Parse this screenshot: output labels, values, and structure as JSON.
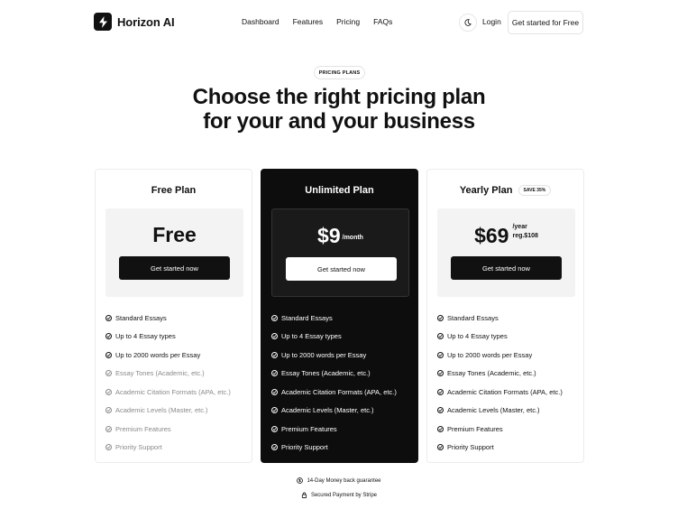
{
  "nav": {
    "brand": "Horizon AI",
    "logo_icon": "lightning-bolt-icon",
    "links": [
      "Dashboard",
      "Features",
      "Pricing",
      "FAQs"
    ],
    "theme_icon": "moon-icon",
    "login": "Login",
    "cta": "Get started for Free"
  },
  "hero": {
    "badge": "PRICING PLANS",
    "title_line1": "Choose the right pricing plan",
    "title_line2": "for your and your business"
  },
  "plans": [
    {
      "name": "Free Plan",
      "price": "Free",
      "button": "Get started now",
      "features": [
        {
          "label": "Standard Essays",
          "included": true
        },
        {
          "label": "Up to 4 Essay types",
          "included": true
        },
        {
          "label": "Up to 2000 words per Essay",
          "included": true
        },
        {
          "label": "Essay Tones (Academic, etc.)",
          "included": false
        },
        {
          "label": "Academic Citation Formats (APA, etc.)",
          "included": false
        },
        {
          "label": "Academic Levels (Master, etc.)",
          "included": false
        },
        {
          "label": "Premium Features",
          "included": false
        },
        {
          "label": "Priority Support",
          "included": false
        }
      ]
    },
    {
      "name": "Unlimited Plan",
      "price": "$9",
      "period": "/month",
      "button": "Get started now",
      "features": [
        {
          "label": "Standard Essays",
          "included": true
        },
        {
          "label": "Up to 4 Essay types",
          "included": true
        },
        {
          "label": "Up to 2000 words per Essay",
          "included": true
        },
        {
          "label": "Essay Tones (Academic, etc.)",
          "included": true
        },
        {
          "label": "Academic Citation Formats (APA, etc.)",
          "included": true
        },
        {
          "label": "Academic Levels (Master, etc.)",
          "included": true
        },
        {
          "label": "Premium Features",
          "included": true
        },
        {
          "label": "Priority Support",
          "included": true
        }
      ]
    },
    {
      "name": "Yearly Plan",
      "badge": "SAVE 35%",
      "price": "$69",
      "period": "/year",
      "regular": "reg.$108",
      "button": "Get started now",
      "features": [
        {
          "label": "Standard Essays",
          "included": true
        },
        {
          "label": "Up to 4 Essay types",
          "included": true
        },
        {
          "label": "Up to 2000 words per Essay",
          "included": true
        },
        {
          "label": "Essay Tones (Academic, etc.)",
          "included": true
        },
        {
          "label": "Academic Citation Formats (APA, etc.)",
          "included": true
        },
        {
          "label": "Academic Levels (Master, etc.)",
          "included": true
        },
        {
          "label": "Premium Features",
          "included": true
        },
        {
          "label": "Priority Support",
          "included": true
        }
      ]
    }
  ],
  "footer": {
    "guarantee": "14-Day Money back guarantee",
    "guarantee_icon": "dollar-coin-icon",
    "secure": "Secured Payment by Stripe",
    "secure_icon": "lock-icon"
  },
  "colors": {
    "accent": "#111111",
    "dark_card": "#0d0d0d",
    "muted_text": "#8a8a8a"
  }
}
